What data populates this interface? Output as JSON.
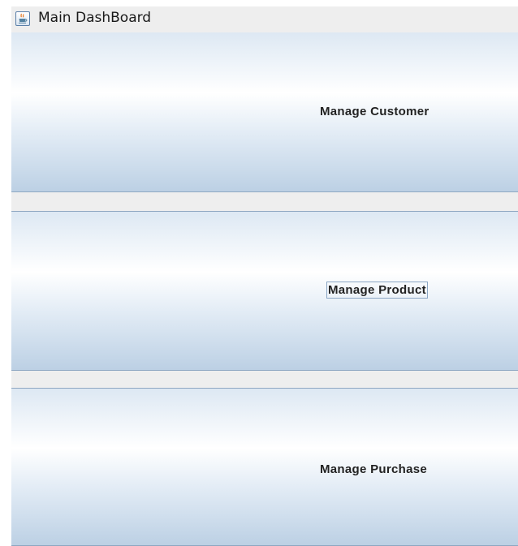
{
  "window": {
    "title": "Main DashBoard",
    "icon": "java-coffee-cup-icon"
  },
  "dashboard": {
    "buttons": [
      {
        "label": "Manage Customer"
      },
      {
        "label": "Manage Product",
        "focused": true
      },
      {
        "label": "Manage Purchase"
      }
    ]
  },
  "colors": {
    "window_background": "#eeeeee",
    "button_gradient_top": "#ffffff",
    "button_gradient_bottom": "#bcd0e4",
    "button_border": "#8ea7c2",
    "label_text": "#222222"
  }
}
